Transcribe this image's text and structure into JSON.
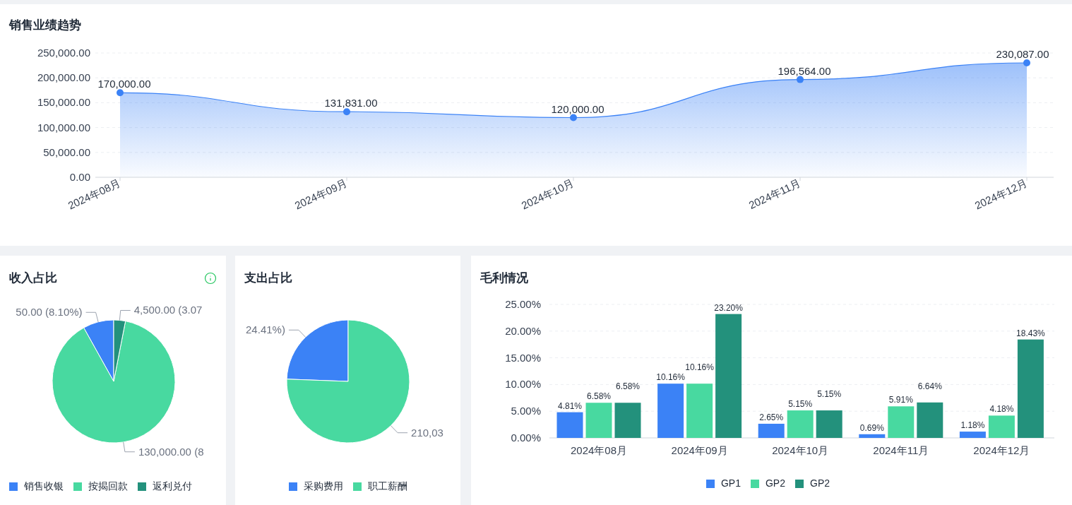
{
  "sales_trend": {
    "title": "销售业绩趋势",
    "chart_data": {
      "type": "area",
      "categories": [
        "2024年08月",
        "2024年09月",
        "2024年10月",
        "2024年11月",
        "2024年12月"
      ],
      "series": [
        {
          "color": "#3b82f6",
          "values": [
            170000,
            131831,
            120000,
            196564,
            230087
          ],
          "value_labels": [
            "170,000.00",
            "131,831.00",
            "120,000.00",
            "196,564.00",
            "230,087.00"
          ]
        }
      ],
      "ylim": [
        0,
        250000
      ],
      "yticks": [
        {
          "value": 0,
          "label": "0.00"
        },
        {
          "value": 50000,
          "label": "50,000.00"
        },
        {
          "value": 100000,
          "label": "100,000.00"
        },
        {
          "value": 150000,
          "label": "150,000.00"
        },
        {
          "value": 200000,
          "label": "200,000.00"
        },
        {
          "value": 250000,
          "label": "250,000.00"
        }
      ],
      "grid": true
    }
  },
  "income_share": {
    "title": "收入占比",
    "info": true,
    "legend": [
      {
        "color": "#3b82f6"
      },
      {
        "color": "#48d9a0"
      },
      {
        "color": "#23917c"
      }
    ],
    "slice_labels": [
      "50.00 (8.10%)",
      "130,000.00 (8",
      "4,500.00 (3.07"
    ],
    "chart_data": {
      "type": "pie",
      "categories": [
        "销售收银",
        "按揭回款",
        "返利兑付"
      ],
      "values": [
        8.1,
        88.83,
        3.07
      ]
    }
  },
  "expense_share": {
    "title": "支出占比",
    "legend": [
      {
        "color": "#3b82f6"
      },
      {
        "color": "#48d9a0"
      }
    ],
    "slice_labels": [
      "24.41%)",
      "210,03"
    ],
    "chart_data": {
      "type": "pie",
      "categories": [
        "采购费用",
        "职工薪酬"
      ],
      "values": [
        24.41,
        75.59
      ]
    }
  },
  "gross_profit": {
    "title": "毛利情况",
    "chart_data": {
      "type": "bar",
      "categories": [
        "2024年08月",
        "2024年09月",
        "2024年10月",
        "2024年11月",
        "2024年12月"
      ],
      "series": [
        {
          "name": "GP1",
          "color": "#3b82f6",
          "values": [
            4.81,
            10.16,
            2.65,
            0.69,
            1.18
          ],
          "value_labels": [
            "4.81%",
            "10.16%",
            "2.65%",
            "0.69%",
            "1.18%"
          ]
        },
        {
          "name": "GP2",
          "color": "#48d9a0",
          "values": [
            6.58,
            10.16,
            5.15,
            5.91,
            4.18
          ],
          "value_labels": [
            "6.58%",
            "10.16%",
            "5.15%",
            "5.91%",
            "4.18%"
          ]
        },
        {
          "name": "GP2",
          "color": "#23917c",
          "values": [
            6.58,
            23.2,
            5.15,
            6.64,
            18.43
          ],
          "value_labels": [
            "6.58%",
            "23.20%",
            "5.15%",
            "6.64%",
            "18.43%"
          ]
        }
      ],
      "ylim": [
        0,
        25
      ],
      "yticks": [
        {
          "value": 0,
          "label": "0.00%"
        },
        {
          "value": 5,
          "label": "5.00%"
        },
        {
          "value": 10,
          "label": "10.00%"
        },
        {
          "value": 15,
          "label": "15.00%"
        },
        {
          "value": 20,
          "label": "20.00%"
        },
        {
          "value": 25,
          "label": "25.00%"
        }
      ],
      "grid": true
    }
  }
}
